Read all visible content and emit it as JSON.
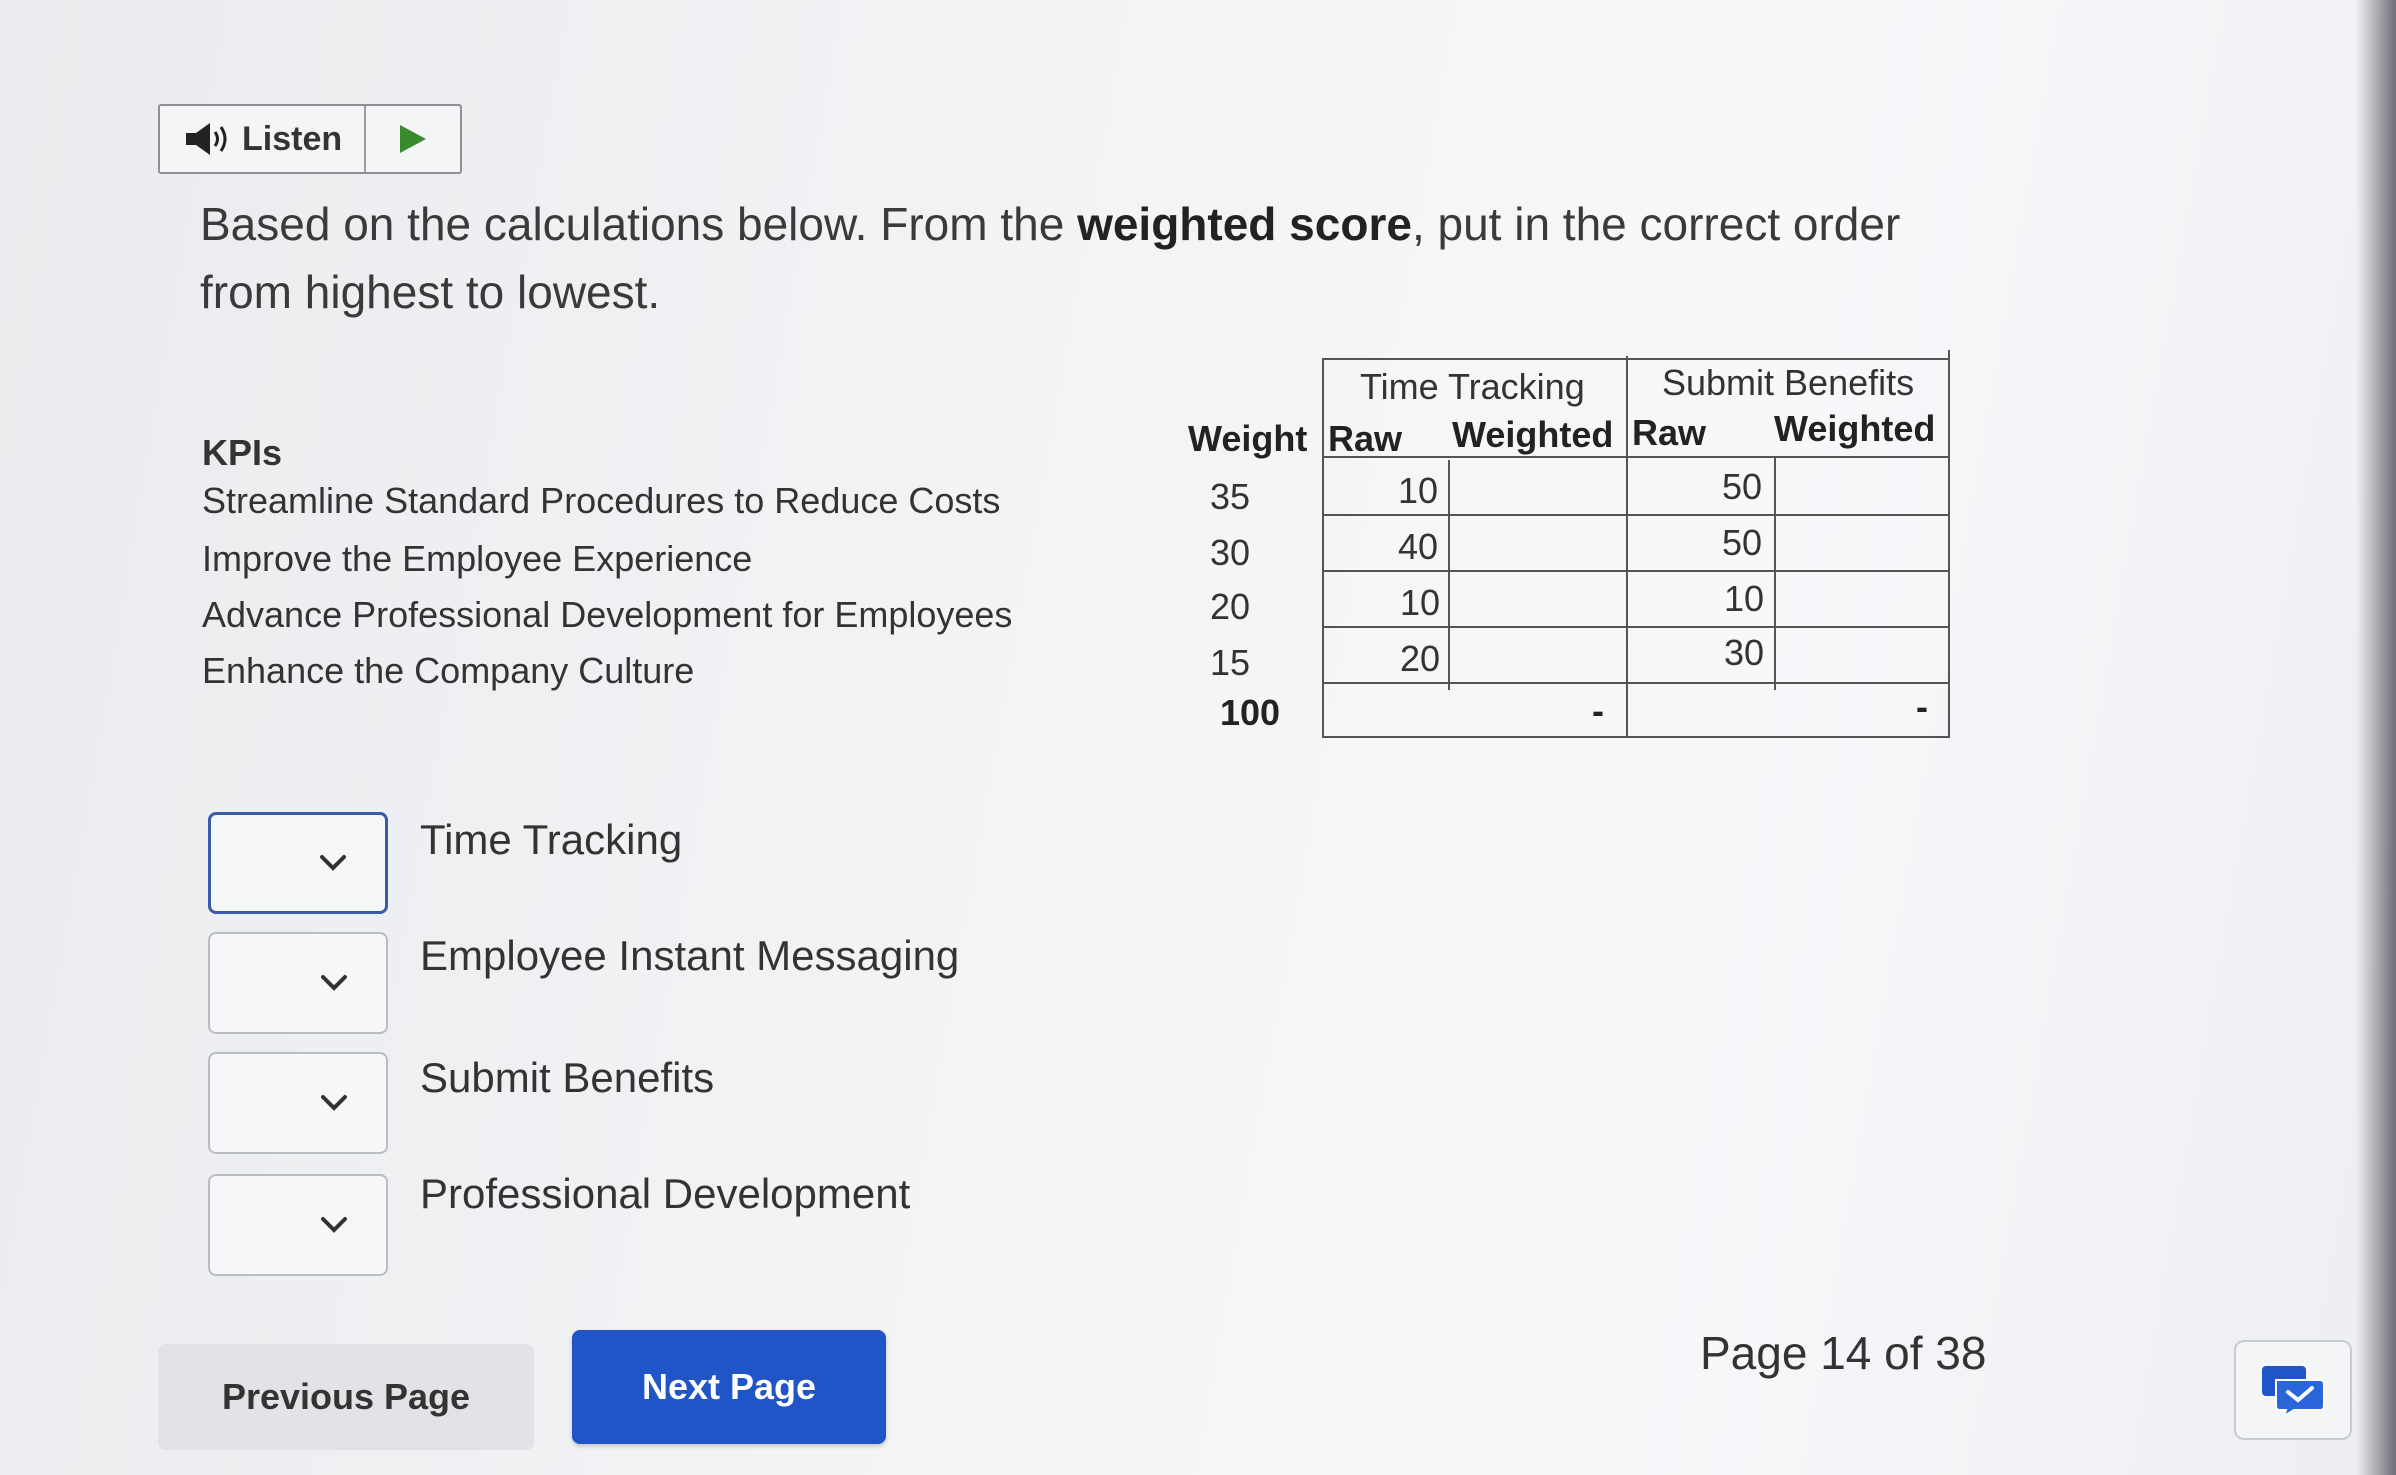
{
  "listen": {
    "label": "Listen"
  },
  "question": {
    "prefix": "Based on the calculations below. From the ",
    "emphasis": "weighted score",
    "suffix": ", put in the correct order from highest to lowest."
  },
  "kpis": {
    "heading": "KPIs",
    "items": [
      "Streamline Standard Procedures to Reduce Costs",
      "Improve the Employee Experience",
      "Advance Professional Development for Employees",
      "Enhance the Company Culture"
    ]
  },
  "weights": {
    "heading": "Weight",
    "values": [
      "35",
      "30",
      "20",
      "15"
    ],
    "total": "100"
  },
  "table": {
    "groups": [
      "Time Tracking",
      "Submit Benefits"
    ],
    "subheads": [
      "Raw",
      "Weighted",
      "Raw",
      "Weighted"
    ],
    "time_tracking_raw": [
      "10",
      "40",
      "10",
      "20"
    ],
    "submit_benefits_raw": [
      "50",
      "50",
      "10",
      "30"
    ],
    "totals": [
      "-",
      "-"
    ]
  },
  "ordering": {
    "items": [
      "Time Tracking",
      "Employee Instant Messaging",
      "Submit Benefits",
      "Professional Development"
    ]
  },
  "nav": {
    "previous": "Previous Page",
    "next": "Next Page",
    "page_info": "Page 14 of 38"
  },
  "colors": {
    "next_button": "#1f55c7",
    "focus_border": "#3b5aa8",
    "play_green": "#3a8a2e"
  }
}
